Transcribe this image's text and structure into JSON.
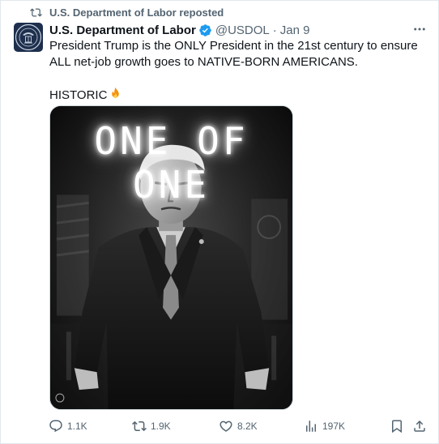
{
  "repost": {
    "icon": "repost-icon",
    "label": "U.S. Department of Labor reposted"
  },
  "author": {
    "avatar": "department-of-labor-seal",
    "display_name": "U.S. Department of Labor",
    "verified_icon": "verified-badge-icon",
    "handle": "@USDOL",
    "separator": "·",
    "date": "Jan 9"
  },
  "more_icon": "more-options-icon",
  "tweet": {
    "line1": "President Trump is the ONLY President in the 21st century to ensure ALL net-job growth goes to NATIVE-BORN AMERICANS.",
    "line2": "HISTORIC",
    "emoji": "fire-emoji"
  },
  "media": {
    "title_text": "ONE OF ONE",
    "style": "black-and-white photo of a man in a dark suit leaning forward"
  },
  "actions": {
    "reply_count": "1.1K",
    "repost_count": "1.9K",
    "like_count": "8.2K",
    "views_count": "197K"
  },
  "colors": {
    "text_primary": "#0f1419",
    "text_secondary": "#536471",
    "verified_blue": "#1d9bf0",
    "border": "#cfd9de"
  }
}
